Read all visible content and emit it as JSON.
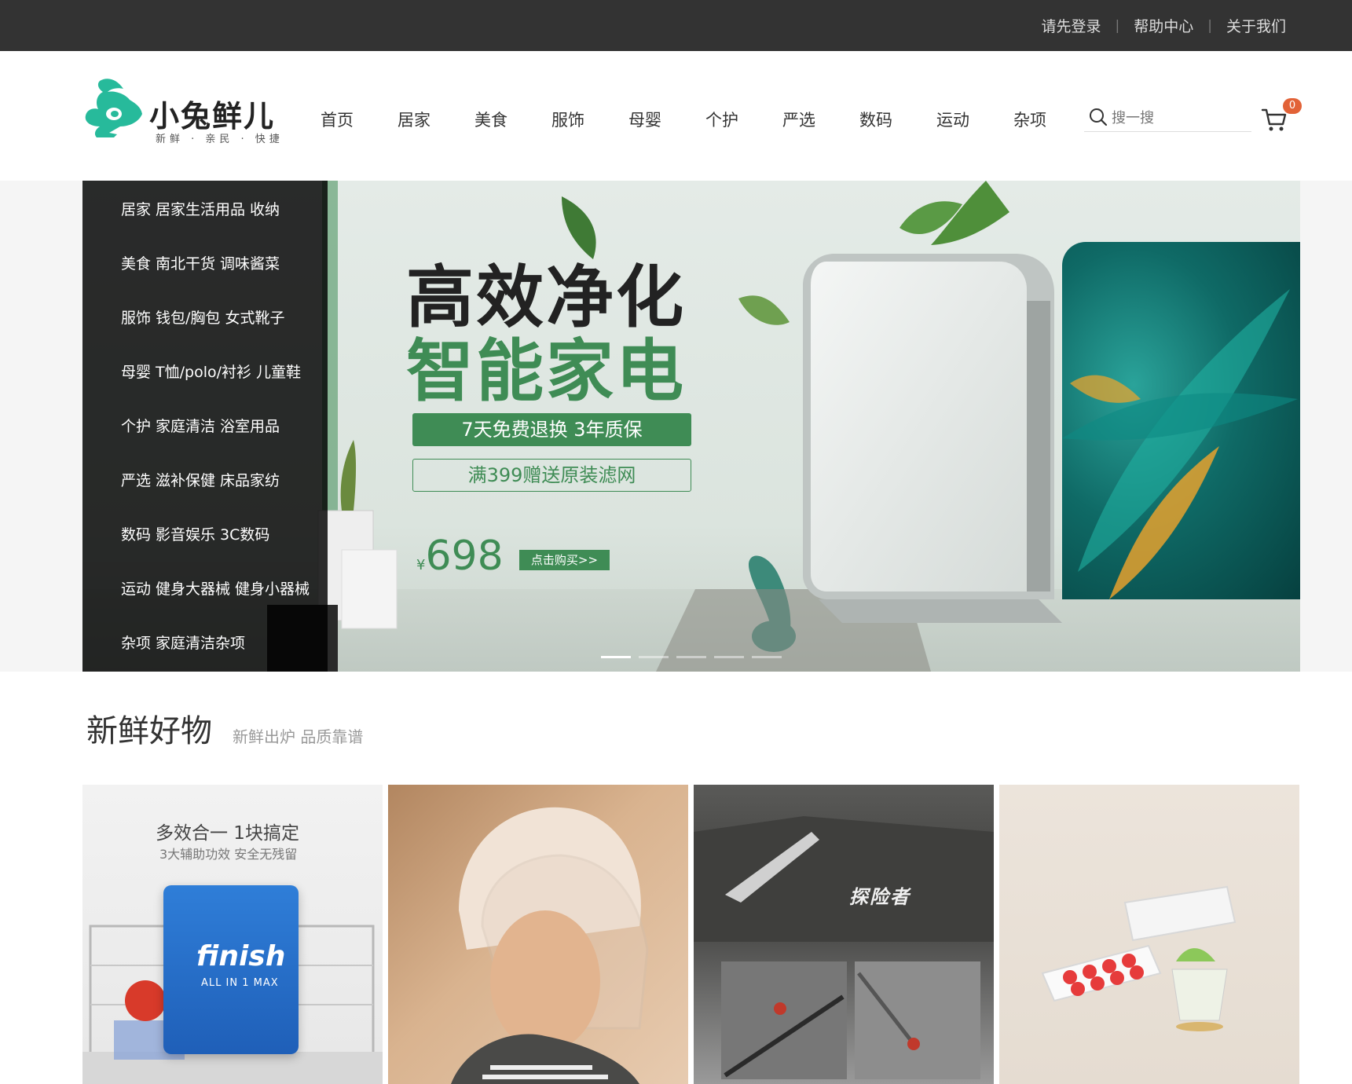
{
  "topbar": {
    "links": [
      "请先登录",
      "帮助中心",
      "关于我们"
    ],
    "separator": "|"
  },
  "header": {
    "logo_text": "小兔鲜儿",
    "logo_slogan": "新鲜 · 亲民 · 快捷",
    "nav": [
      "首页",
      "居家",
      "美食",
      "服饰",
      "母婴",
      "个护",
      "严选",
      "数码",
      "运动",
      "杂项"
    ],
    "search_placeholder": "搜一搜",
    "cart_count": "0"
  },
  "banner": {
    "categories": [
      {
        "name": "居家",
        "subs": "居家生活用品 收纳"
      },
      {
        "name": "美食",
        "subs": "南北干货 调味酱菜"
      },
      {
        "name": "服饰",
        "subs": "钱包/胸包 女式靴子"
      },
      {
        "name": "母婴",
        "subs": "T恤/polo/衬衫 儿童鞋"
      },
      {
        "name": "个护",
        "subs": "家庭清洁 浴室用品"
      },
      {
        "name": "严选",
        "subs": "滋补保健 床品家纺"
      },
      {
        "name": "数码",
        "subs": "影音娱乐 3C数码"
      },
      {
        "name": "运动",
        "subs": "健身大器械 健身小器械"
      },
      {
        "name": "杂项",
        "subs": "家庭清洁杂项"
      }
    ],
    "title_line1": "高效净化",
    "title_line2": "智能家电",
    "promo1": "7天免费退换 3年质保",
    "promo2": "满399赠送原装滤网",
    "currency": "¥",
    "price": "698",
    "buy_label": "点击购买>>",
    "slide_count": 5,
    "active_slide": 0,
    "accent_color": "#3f8c55"
  },
  "section": {
    "title": "新鲜好物",
    "subtitle": "新鲜出炉 品质靠谱"
  },
  "products": [
    {
      "icon": "dishwasher-tablet-image",
      "headline": "多效合一 1块搞定",
      "tagline": "3大辅助功效 安全无残留",
      "brand": "finish",
      "brand_sub": "ALL IN 1 MAX"
    },
    {
      "icon": "helmet-image"
    },
    {
      "icon": "umbrella-image",
      "brand": "探险者"
    },
    {
      "icon": "ice-tray-image"
    }
  ]
}
